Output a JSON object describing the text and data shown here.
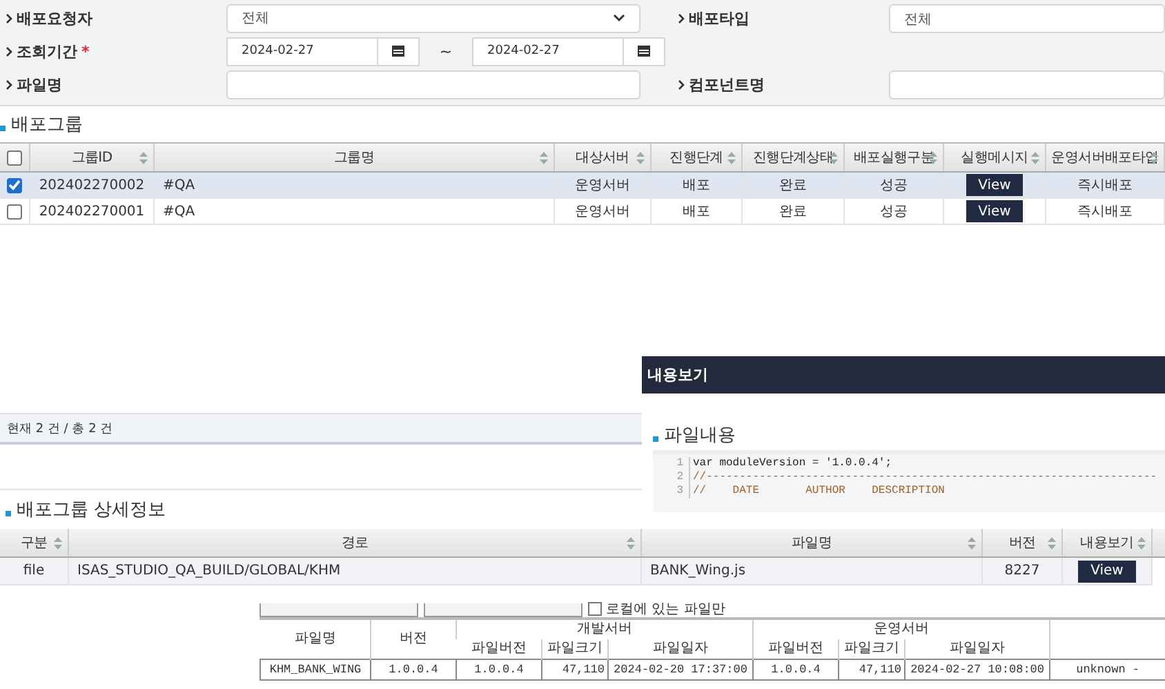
{
  "filter_rows": [
    [
      {
        "label": "배포요청자",
        "kind": "select",
        "value": "전체"
      },
      {
        "label": "배포타입",
        "kind": "text",
        "value": "전체"
      }
    ],
    [
      {
        "label": "조회기간",
        "kind": "date_range",
        "required_mark": "*",
        "from": "2024-02-27",
        "separator": "~",
        "to": "2024-02-27"
      }
    ],
    [
      {
        "label": "파일명",
        "kind": "text"
      },
      {
        "label": "컴포넌트명",
        "kind": "text"
      }
    ]
  ],
  "group_grid": {
    "title": "배포그룹",
    "all_checked": false,
    "columns": [
      "그룹ID",
      "그룹명",
      "대상서버",
      "진행단계",
      "진행단계상태",
      "배포실행구분",
      "실행메시지",
      "운영서버배포타입"
    ],
    "rows": [
      {
        "checked": true,
        "cells": [
          "202402270002",
          "#QA",
          "운영서버",
          "배포",
          "완료",
          "성공"
        ],
        "action": "View",
        "last": "즉시배포"
      },
      {
        "checked": false,
        "cells": [
          "202402270001",
          "#QA",
          "운영서버",
          "배포",
          "완료",
          "성공"
        ],
        "action": "View",
        "last": "즉시배포"
      }
    ],
    "footer": "현재 2 건 / 총 2 건"
  },
  "detail_grid": {
    "title": "배포그룹 상세정보",
    "columns": [
      "구분",
      "경로",
      "파일명",
      "버전",
      "내용보기"
    ],
    "rows": [
      {
        "cells": [
          "file",
          "ISAS_STUDIO_QA_BUILD/GLOBAL/KHM",
          "BANK_Wing.js",
          "8227"
        ],
        "action": "View"
      }
    ]
  },
  "viewer": {
    "title": "내용보기",
    "section": "파일내용",
    "code_lines": [
      {
        "number": "1",
        "kind": "code",
        "text": "var moduleVersion = '1.0.0.4';"
      },
      {
        "number": "2",
        "kind": "comment",
        "text": "//--------------------------------------------------------------------"
      },
      {
        "number": "3",
        "kind": "comment",
        "text": "//    DATE       AUTHOR    DESCRIPTION"
      }
    ]
  },
  "compare": {
    "local_only": {
      "label": "로컬에 있는 파일만",
      "checked": false
    },
    "columns": [
      {
        "label": "파일명"
      },
      {
        "label": "버전"
      },
      {
        "label": "개발서버",
        "colspan": 3,
        "children": [
          "파일버전",
          "파일크기",
          "파일일자"
        ]
      },
      {
        "label": "운영서버",
        "colspan": 3,
        "children": [
          "파일버전",
          "파일크기",
          "파일일자"
        ]
      }
    ],
    "rows": [
      {
        "cells": [
          "KHM_BANK_WING",
          "1.0.0.4",
          "1.0.0.4",
          "47,110",
          "2024-02-20 17:37:00",
          "1.0.0.4",
          "47,110",
          "2024-02-27 10:08:00",
          "unknown -"
        ]
      }
    ]
  }
}
